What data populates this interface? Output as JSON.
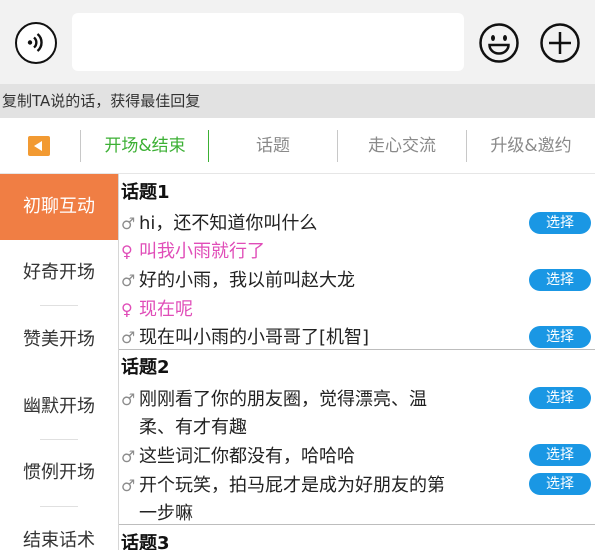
{
  "input": {
    "placeholder": ""
  },
  "hint": {
    "text": "复制TA说的话，获得最佳回复"
  },
  "tabs": [
    {
      "label": "开场&结束",
      "active": true
    },
    {
      "label": "话题",
      "active": false
    },
    {
      "label": "走心交流",
      "active": false
    },
    {
      "label": "升级&邀约",
      "active": false
    }
  ],
  "categories": [
    {
      "label": "初聊互动",
      "active": true
    },
    {
      "label": "好奇开场",
      "active": false
    },
    {
      "label": "赞美开场",
      "active": false
    },
    {
      "label": "幽默开场",
      "active": false
    },
    {
      "label": "惯例开场",
      "active": false
    },
    {
      "label": "结束话术",
      "active": false
    }
  ],
  "topics": [
    {
      "title": "话题1",
      "lines": [
        {
          "gender": "male",
          "icon": "♂",
          "text": "hi，还不知道你叫什么",
          "select": "选择"
        },
        {
          "gender": "female",
          "icon": "♀",
          "text": "叫我小雨就行了"
        },
        {
          "gender": "male",
          "icon": "♂",
          "text": "好的小雨，我以前叫赵大龙",
          "select": "选择"
        },
        {
          "gender": "female",
          "icon": "♀",
          "text": "现在呢"
        },
        {
          "gender": "male",
          "icon": "♂",
          "text": "现在叫小雨的小哥哥了[机智]",
          "select": "选择"
        }
      ]
    },
    {
      "title": "话题2",
      "lines": [
        {
          "gender": "male",
          "icon": "♂",
          "text": "刚刚看了你的朋友圈，觉得漂亮、温",
          "text2": "柔、有才有趣",
          "select": "选择"
        },
        {
          "gender": "male",
          "icon": "♂",
          "text": "这些词汇你都没有，哈哈哈",
          "select": "选择"
        },
        {
          "gender": "male",
          "icon": "♂",
          "text": "开个玩笑，拍马屁才是成为好朋友的第",
          "text2": "一步嘛",
          "select": "选择"
        }
      ]
    },
    {
      "title": "话题3"
    }
  ],
  "colors": {
    "accent_green": "#3cb034",
    "active_category": "#f07e44",
    "select_button": "#1a97e4",
    "female_text": "#e04db8",
    "back_button": "#f29a32"
  },
  "icons": [
    "voice-icon",
    "emoji-icon",
    "plus-icon",
    "back-arrow-icon",
    "male-icon",
    "female-icon"
  ]
}
